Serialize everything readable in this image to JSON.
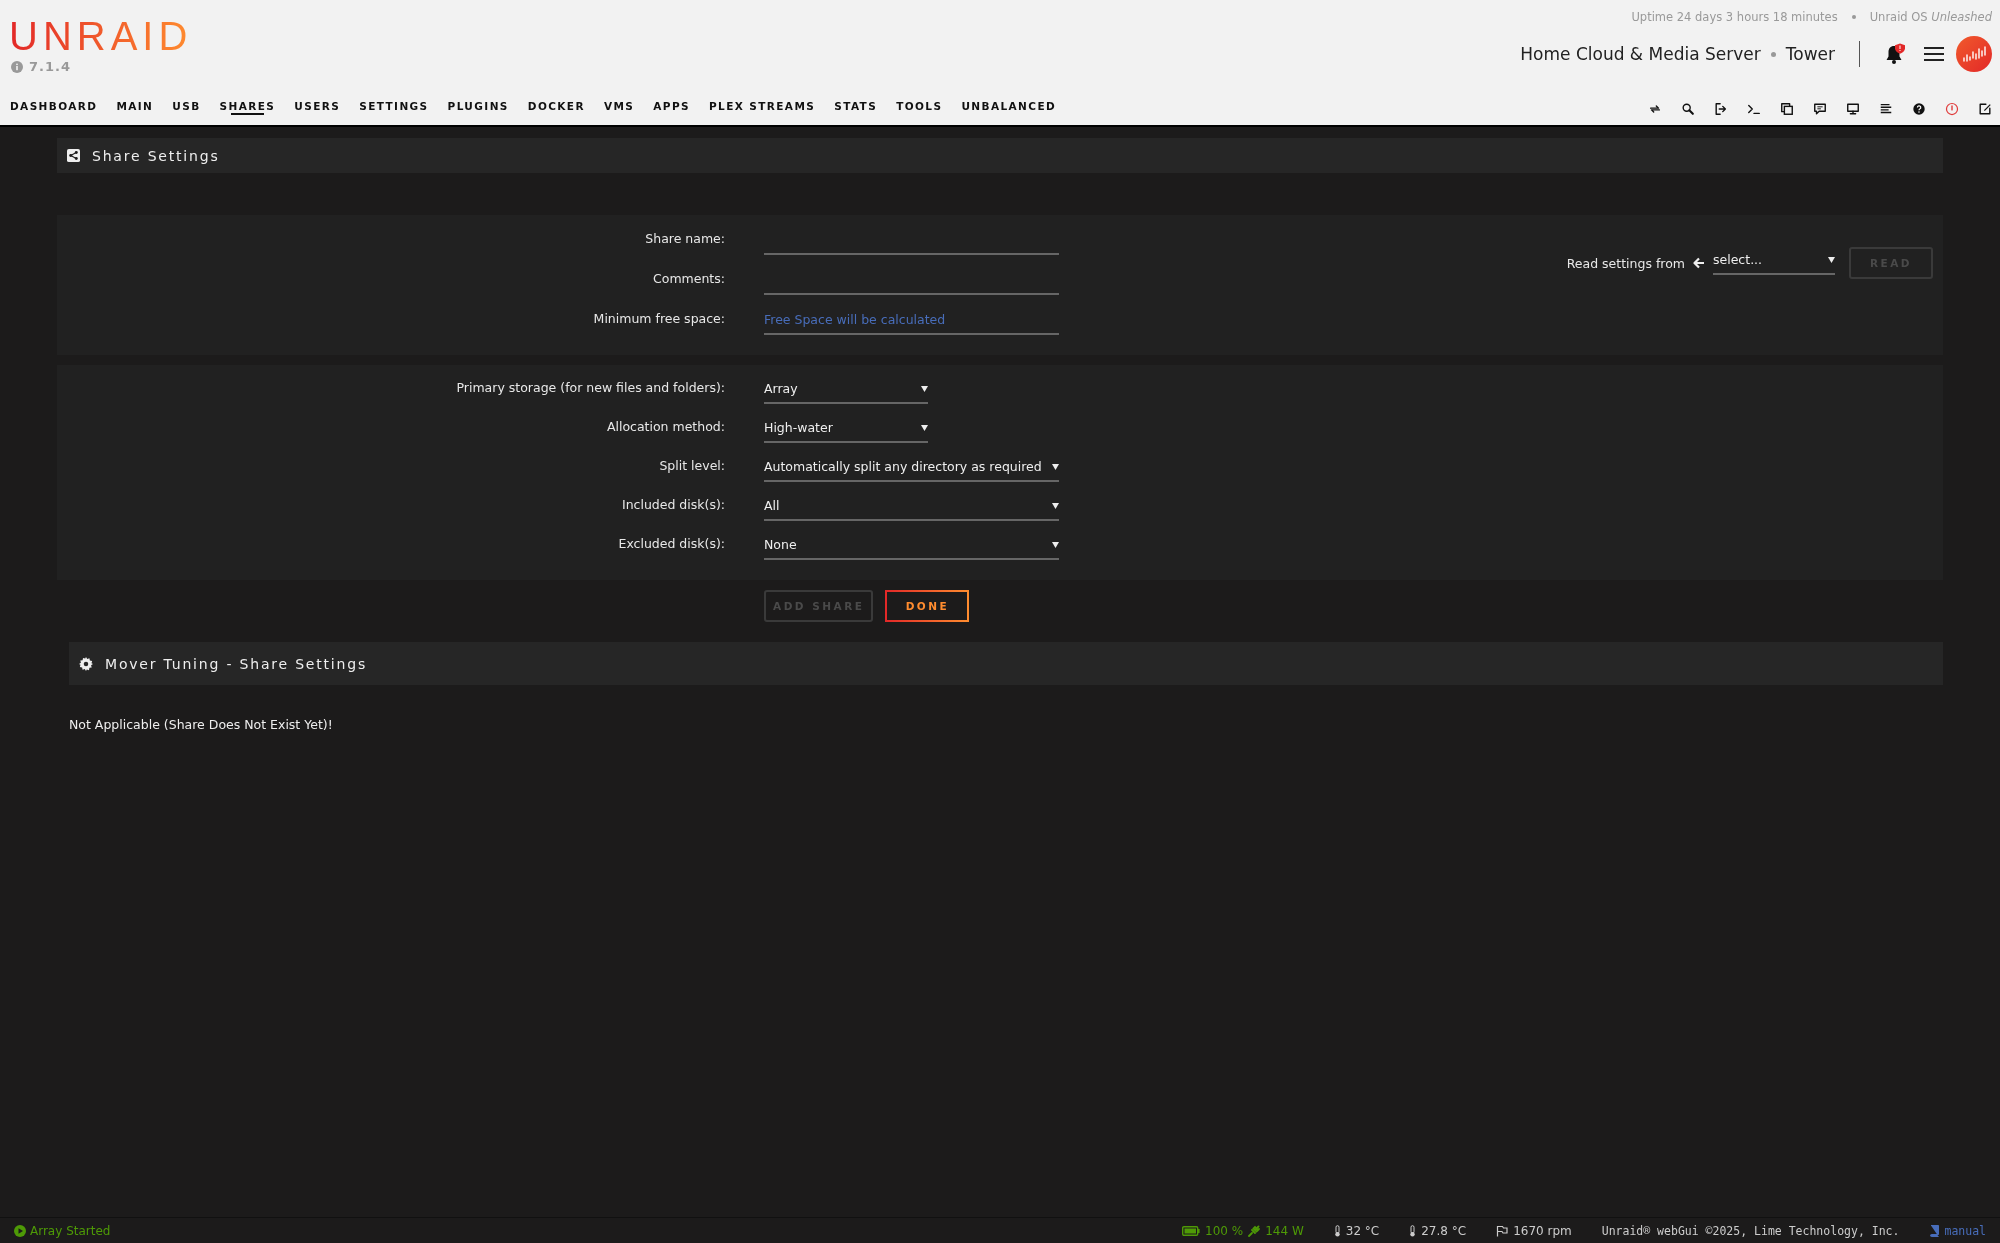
{
  "header": {
    "logo": "UNRAID",
    "version": "7.1.4",
    "uptime": "Uptime 24 days 3 hours 18 minutes",
    "os": "Unraid OS *Unleashed*",
    "server_description": "Home Cloud & Media Server",
    "server_name": "Tower",
    "notification_alert": true
  },
  "nav": [
    {
      "label": "DASHBOARD",
      "selected": false
    },
    {
      "label": "MAIN",
      "selected": false
    },
    {
      "label": "USB",
      "selected": false
    },
    {
      "label": "SHARES",
      "selected": true
    },
    {
      "label": "USERS",
      "selected": false
    },
    {
      "label": "SETTINGS",
      "selected": false
    },
    {
      "label": "PLUGINS",
      "selected": false
    },
    {
      "label": "DOCKER",
      "selected": false
    },
    {
      "label": "VMS",
      "selected": false
    },
    {
      "label": "APPS",
      "selected": false
    },
    {
      "label": "PLEX STREAMS",
      "selected": false
    },
    {
      "label": "STATS",
      "selected": false
    },
    {
      "label": "TOOLS",
      "selected": false
    },
    {
      "label": "UNBALANCED",
      "selected": false
    }
  ],
  "share_settings": {
    "title": "Share Settings",
    "fields": [
      {
        "label": "Share name:",
        "kind": "text"
      },
      {
        "label": "Comments:",
        "kind": "text"
      },
      {
        "label": "Minimum free space:",
        "kind": "text",
        "placeholder": "Free Space will be calculated"
      }
    ],
    "read_settings": {
      "label": "Read settings from",
      "select": "select...",
      "button": "READ",
      "disabled": true
    },
    "storage_fields": [
      {
        "label": "Primary storage (for new files and folders):",
        "value": "Array",
        "kind": "short"
      },
      {
        "label": "Allocation method:",
        "value": "High-water",
        "kind": "short"
      },
      {
        "label": "Split level:",
        "value": "Automatically split any directory as required",
        "kind": "wide"
      },
      {
        "label": "Included disk(s):",
        "value": "All",
        "kind": "wide"
      },
      {
        "label": "Excluded disk(s):",
        "value": "None",
        "kind": "wide"
      }
    ],
    "buttons": [
      {
        "label": "ADD SHARE",
        "disabled": true
      },
      {
        "label": "DONE",
        "disabled": false
      }
    ]
  },
  "mover": {
    "title": "Mover Tuning - Share Settings",
    "message": "Not Applicable (Share Does Not Exist Yet)!"
  },
  "status_bar": {
    "array_status": "Array Started",
    "battery": "100 %",
    "power": "144 W",
    "temperatures": [
      "32 °C",
      "27.8 °C"
    ],
    "fan": "1670 rpm",
    "copyright": "Unraid® webGui ©2025, Lime Technology, Inc.",
    "manual_link": "manual"
  }
}
